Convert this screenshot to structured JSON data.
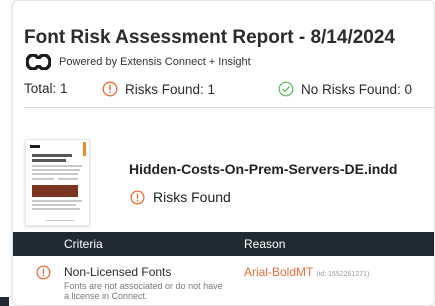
{
  "report": {
    "title": "Font Risk Assessment Report - 8/14/2024",
    "powered_by": "Powered by Extensis Connect + Insight",
    "summary": {
      "total": "Total: 1",
      "risks_found": "Risks Found: 1",
      "no_risks_found": "No Risks Found: 0"
    }
  },
  "file": {
    "name": "Hidden-Costs-On-Prem-Servers-DE.indd",
    "status": "Risks Found"
  },
  "table": {
    "headers": {
      "criteria": "Criteria",
      "reason": "Reason"
    },
    "rows": [
      {
        "criteria": "Non-Licensed Fonts",
        "description": "Fonts are not associated or do not have a license in Connect.",
        "reason_font": "Arial-BoldMT",
        "reason_id": "(id: 1552261271)"
      }
    ]
  },
  "colors": {
    "risk_orange": "#ea6f3a",
    "ok_green": "#5cb85c",
    "header_dark": "#1f2a35"
  },
  "icons": {
    "logo": "extensis-logo-icon",
    "risk": "alert-circle-icon",
    "ok": "check-circle-icon"
  }
}
